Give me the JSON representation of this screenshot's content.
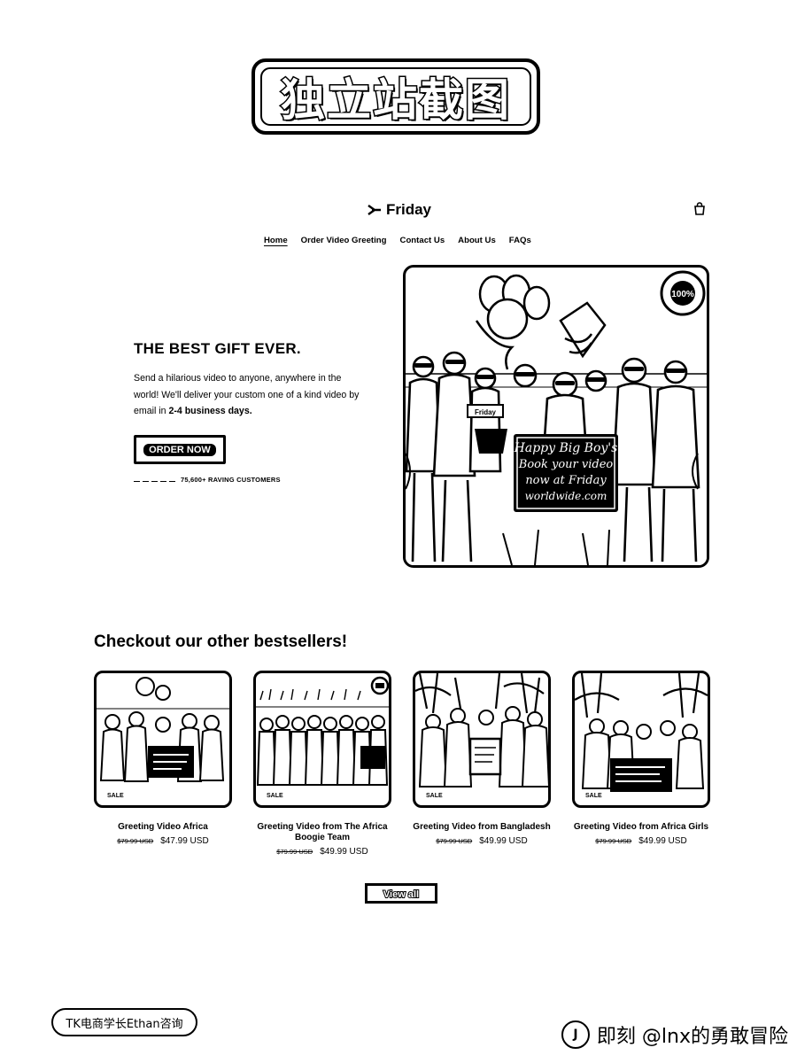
{
  "banner": {
    "text": "独立站截图"
  },
  "header": {
    "logo_text": "Friday",
    "logo_icon": "friday-bolt-icon",
    "cart_icon": "cart-icon"
  },
  "nav": {
    "items": [
      {
        "label": "Home",
        "active": true
      },
      {
        "label": "Order Video Greeting",
        "active": false
      },
      {
        "label": "Contact Us",
        "active": false
      },
      {
        "label": "About Us",
        "active": false
      },
      {
        "label": "FAQs",
        "active": false
      }
    ]
  },
  "hero": {
    "title": "THE BEST GIFT EVER.",
    "body_plain": "Send a hilarious video to anyone, anywhere in the world! We'll deliver your custom one of a kind video by email in ",
    "body_bold": "2-4 business days.",
    "cta_label": "ORDER NOW",
    "rating_text": "75,600+ RAVING CUSTOMERS",
    "rating_stars": 5,
    "image_sign_text": "Happy Big Boy's Book your video now at Friday worldwide.com",
    "image_badge_text": "100%",
    "image_banner_text": "Friday"
  },
  "bestsellers": {
    "title": "Checkout our other bestsellers!",
    "products": [
      {
        "title": "Greeting Video Africa",
        "old_price": "$79.99 USD",
        "price": "$47.99 USD",
        "badge": "SALE"
      },
      {
        "title": "Greeting Video from The Africa Boogie Team",
        "old_price": "$79.99 USD",
        "price": "$49.99 USD",
        "badge": "SALE"
      },
      {
        "title": "Greeting Video from Bangladesh",
        "old_price": "$79.99 USD",
        "price": "$49.99 USD",
        "badge": "SALE"
      },
      {
        "title": "Greeting Video from Africa Girls",
        "old_price": "$79.99 USD",
        "price": "$49.99 USD",
        "badge": "SALE"
      }
    ],
    "view_all_label": "View all"
  },
  "footer": {
    "tag_text": "TK电商学长Ethan咨询",
    "watermark_text": "即刻 @lnx的勇敢冒险",
    "watermark_icon": "jike-logo-icon"
  }
}
